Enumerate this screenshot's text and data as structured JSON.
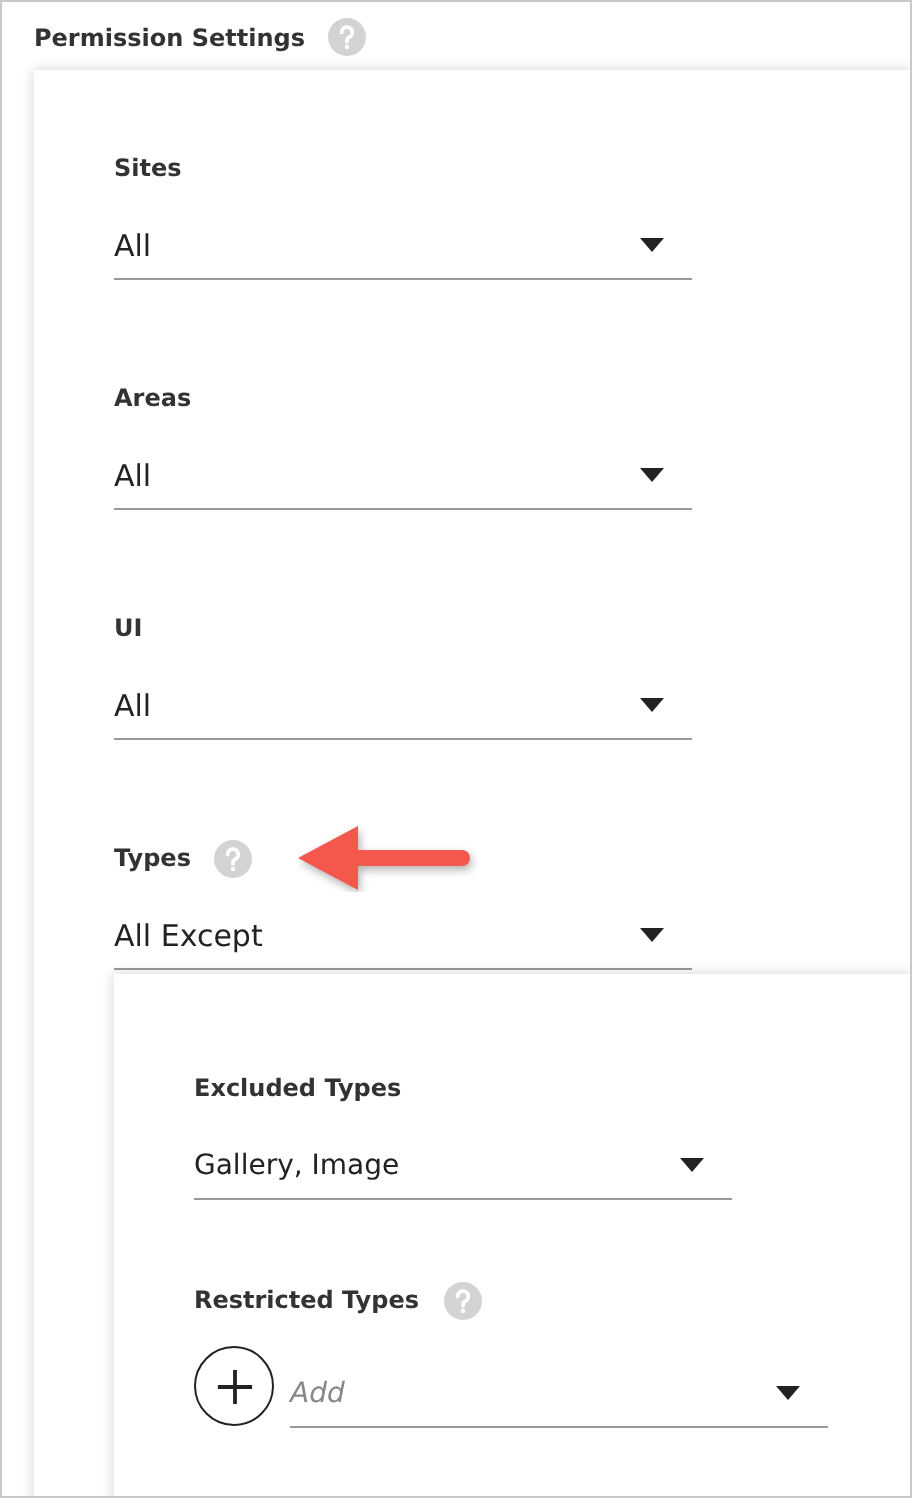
{
  "section": {
    "title": "Permission Settings",
    "help": true
  },
  "fields": [
    {
      "label": "Sites",
      "value": "All",
      "help": false,
      "annotated": false
    },
    {
      "label": "Areas",
      "value": "All",
      "help": false,
      "annotated": false
    },
    {
      "label": "UI",
      "value": "All",
      "help": false,
      "annotated": false
    },
    {
      "label": "Types",
      "value": "All Except",
      "help": true,
      "annotated": true
    }
  ],
  "subfields": [
    {
      "kind": "select",
      "label": "Excluded Types",
      "value": "Gallery, Image",
      "help": false
    },
    {
      "kind": "add",
      "label": "Restricted Types",
      "placeholder": "Add",
      "help": true
    }
  ]
}
